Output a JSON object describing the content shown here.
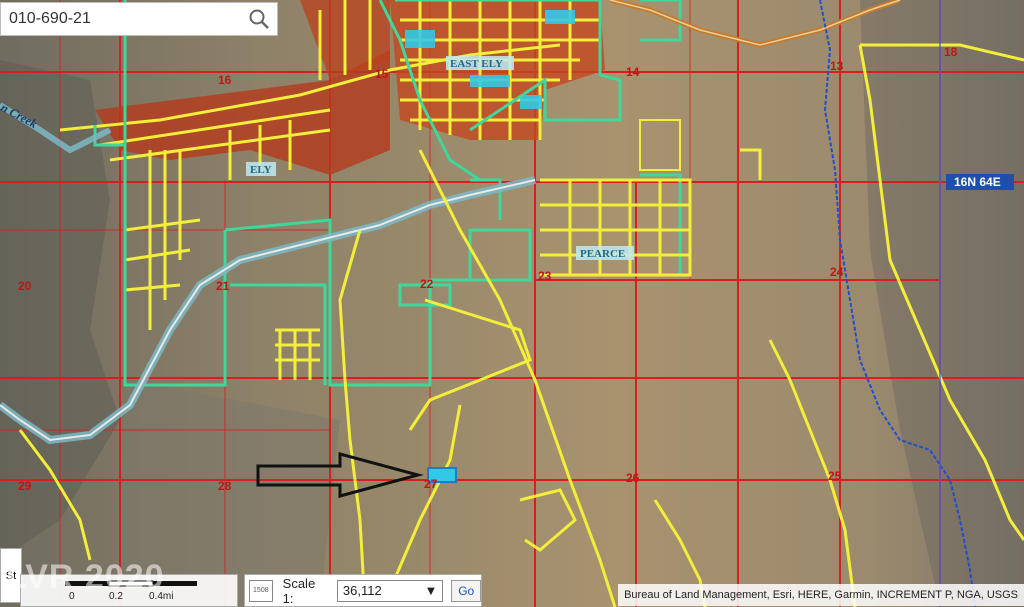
{
  "search": {
    "value": "010-690-21"
  },
  "map": {
    "place_labels": {
      "east_ely": "EAST ELY",
      "ely": "ELY",
      "pearce": "PEARCE"
    },
    "creek_label": "n Creek",
    "township_label": "16N 64E",
    "sections": [
      "16",
      "15",
      "14",
      "13",
      "18",
      "20",
      "21",
      "22",
      "23",
      "24",
      "25",
      "26",
      "27",
      "28",
      "29"
    ]
  },
  "scalebar": {
    "prefix": "St",
    "ticks": [
      "0",
      "0.2",
      "0.4mi"
    ]
  },
  "controls": {
    "icon_text": "1508",
    "scale_label": "Scale 1:",
    "scale_value": "36,112",
    "go_label": "Go"
  },
  "attribution": "Bureau of Land Management, Esri, HERE, Garmin, INCREMENT P, NGA, USGS",
  "watermark": "LVR 2020",
  "colors": {
    "parcel_red": "#d81f1f",
    "road_yellow": "#f2ee3a",
    "boundary_green": "#3fd79a",
    "water_cyan": "#32c8e8",
    "terrain": "#a08e6c",
    "mountain": "#6b6a5e"
  }
}
